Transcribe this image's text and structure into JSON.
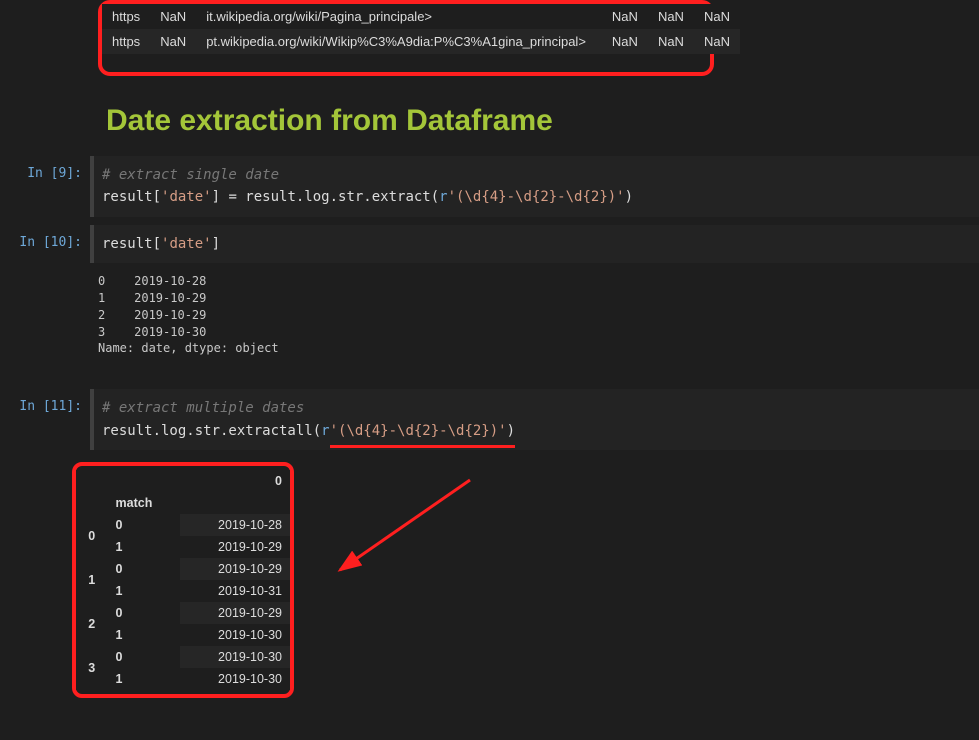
{
  "top_rows": [
    {
      "scheme": "https",
      "a": "NaN",
      "url": "it.wikipedia.org/wiki/Pagina_principale>",
      "b": "NaN",
      "c": "NaN",
      "d": "NaN"
    },
    {
      "scheme": "https",
      "a": "NaN",
      "url": "pt.wikipedia.org/wiki/Wikip%C3%A9dia:P%C3%A1gina_principal>",
      "b": "NaN",
      "c": "NaN",
      "d": "NaN"
    }
  ],
  "heading": "Date extraction from Dataframe",
  "cells": {
    "c9": {
      "prompt": "In [9]:",
      "line1_comment": "# extract single date",
      "line2_pre": "result[",
      "line2_key": "'date'",
      "line2_mid": "] = result.log.str.extract(",
      "line2_rprefix": "r",
      "line2_regex": "'(\\d{4}-\\d{2}-\\d{2})'",
      "line2_post": ")"
    },
    "c10": {
      "prompt": "In [10]:",
      "line1_pre": "result[",
      "line1_key": "'date'",
      "line1_post": "]",
      "out": "0    2019-10-28\n1    2019-10-29\n2    2019-10-29\n3    2019-10-30\nName: date, dtype: object"
    },
    "c11": {
      "prompt": "In [11]:",
      "line1_comment": "# extract multiple dates",
      "line2_pre": "result.log.str.extractall(",
      "line2_rprefix": "r",
      "line2_regex": "'(\\d{4}-\\d{2}-\\d{2})'",
      "line2_post": ")",
      "df": {
        "col_header": "0",
        "match_header": "match",
        "groups": [
          {
            "idx": "0",
            "rows": [
              {
                "m": "0",
                "v": "2019-10-28"
              },
              {
                "m": "1",
                "v": "2019-10-29"
              }
            ]
          },
          {
            "idx": "1",
            "rows": [
              {
                "m": "0",
                "v": "2019-10-29"
              },
              {
                "m": "1",
                "v": "2019-10-31"
              }
            ]
          },
          {
            "idx": "2",
            "rows": [
              {
                "m": "0",
                "v": "2019-10-29"
              },
              {
                "m": "1",
                "v": "2019-10-30"
              }
            ]
          },
          {
            "idx": "3",
            "rows": [
              {
                "m": "0",
                "v": "2019-10-30"
              },
              {
                "m": "1",
                "v": "2019-10-30"
              }
            ]
          }
        ]
      }
    }
  }
}
